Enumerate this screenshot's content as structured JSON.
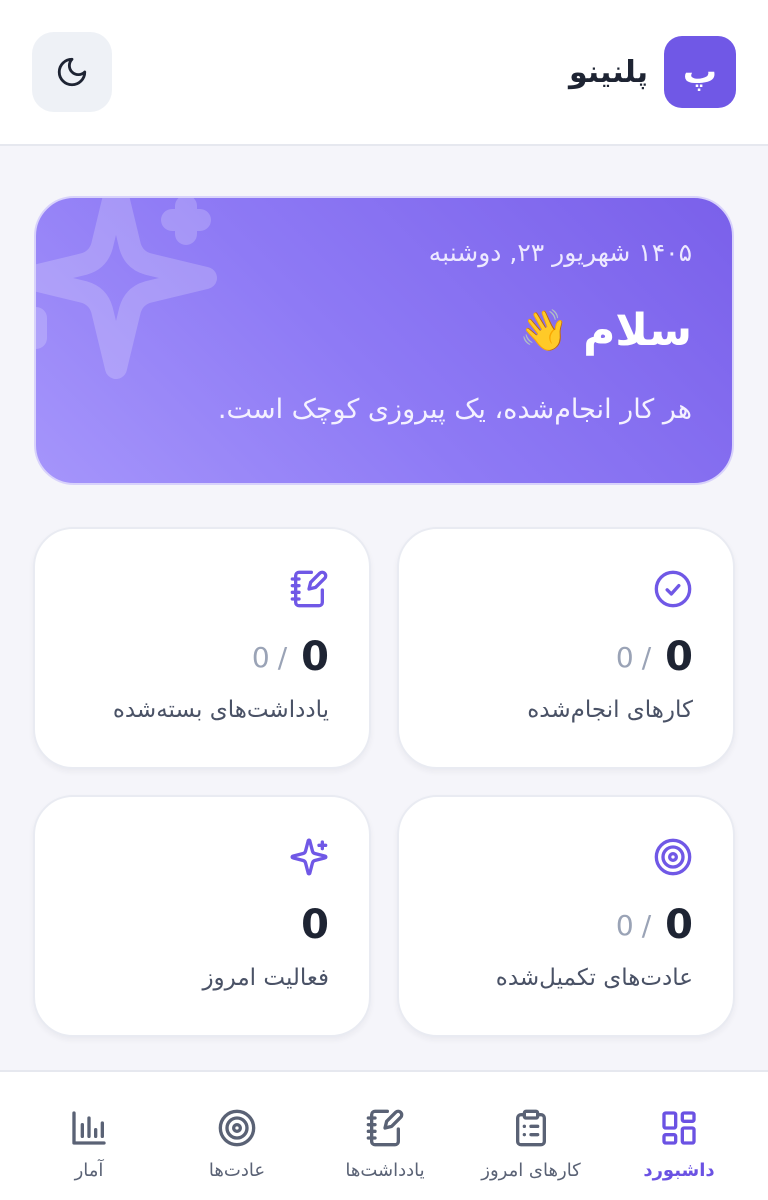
{
  "header": {
    "logo_letter": "پ",
    "app_name": "پلنینو",
    "theme_icon": "moon-icon"
  },
  "hero": {
    "date": "۱۴۰۵ شهریور ۲۳, دوشنبه",
    "greeting": "سلام",
    "greeting_emoji": "👋",
    "subtitle": "هر کار انجام‌شده، یک پیروزی کوچک است."
  },
  "stats": [
    {
      "label": "کارهای انجام‌شده",
      "count": "0",
      "separator": "/",
      "total": "0",
      "icon": "check-circle-icon"
    },
    {
      "label": "یادداشت‌های بسته‌شده",
      "count": "0",
      "separator": "/",
      "total": "0",
      "icon": "notebook-pen-icon"
    },
    {
      "label": "عادت‌های تکمیل‌شده",
      "count": "0",
      "separator": "/",
      "total": "0",
      "icon": "target-icon"
    },
    {
      "label": "فعالیت امروز",
      "count": "0",
      "icon": "sparkles-icon"
    }
  ],
  "nav": [
    {
      "label": "داشبورد",
      "icon": "dashboard-grid-icon",
      "active": true
    },
    {
      "label": "کارهای امروز",
      "icon": "clipboard-list-icon",
      "active": false
    },
    {
      "label": "یادداشت‌ها",
      "icon": "notebook-pen-icon",
      "active": false
    },
    {
      "label": "عادت‌ها",
      "icon": "target-icon",
      "active": false
    },
    {
      "label": "آمار",
      "icon": "bar-chart-icon",
      "active": false
    }
  ],
  "colors": {
    "accent": "#7058e6",
    "text_primary": "#1e2433",
    "text_muted": "#9aa3b6",
    "background": "#f5f5fa"
  }
}
